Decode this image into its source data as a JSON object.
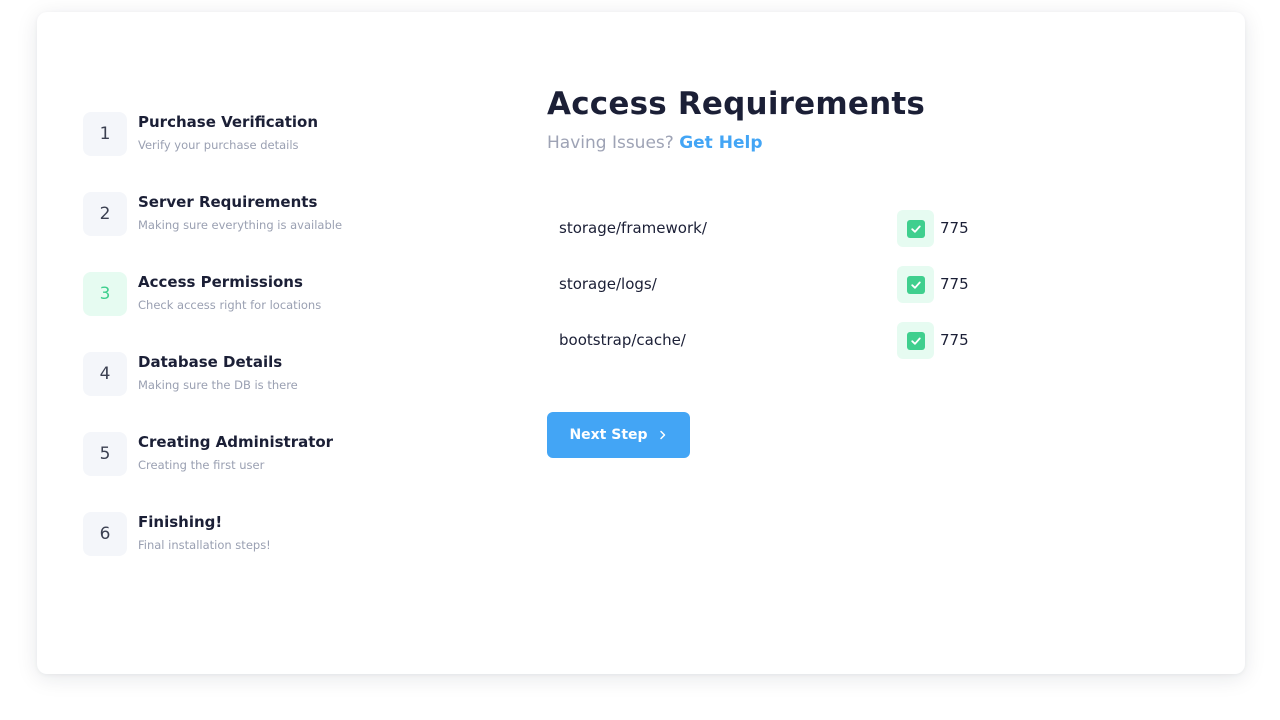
{
  "steps": [
    {
      "number": "1",
      "title": "Purchase Verification",
      "subtitle": "Verify your purchase details"
    },
    {
      "number": "2",
      "title": "Server Requirements",
      "subtitle": "Making sure everything is available"
    },
    {
      "number": "3",
      "title": "Access Permissions",
      "subtitle": "Check access right for locations"
    },
    {
      "number": "4",
      "title": "Database Details",
      "subtitle": "Making sure the DB is there"
    },
    {
      "number": "5",
      "title": "Creating Administrator",
      "subtitle": "Creating the first user"
    },
    {
      "number": "6",
      "title": "Finishing!",
      "subtitle": "Final installation steps!"
    }
  ],
  "active_step": 3,
  "main": {
    "heading": "Access Requirements",
    "issues_text": "Having Issues?",
    "help_link": "Get Help"
  },
  "permissions": [
    {
      "path": "storage/framework/",
      "value": "775",
      "checked": true
    },
    {
      "path": "storage/logs/",
      "value": "775",
      "checked": true
    },
    {
      "path": "bootstrap/cache/",
      "value": "775",
      "checked": true
    }
  ],
  "next_button": {
    "label": "Next Step",
    "icon": "arrow-right-icon"
  },
  "colors": {
    "accent": "#43a5f5",
    "success": "#3fcf8e",
    "success_bg": "#e6fbf1",
    "text": "#1b1f36",
    "muted": "#9aa0b2"
  }
}
